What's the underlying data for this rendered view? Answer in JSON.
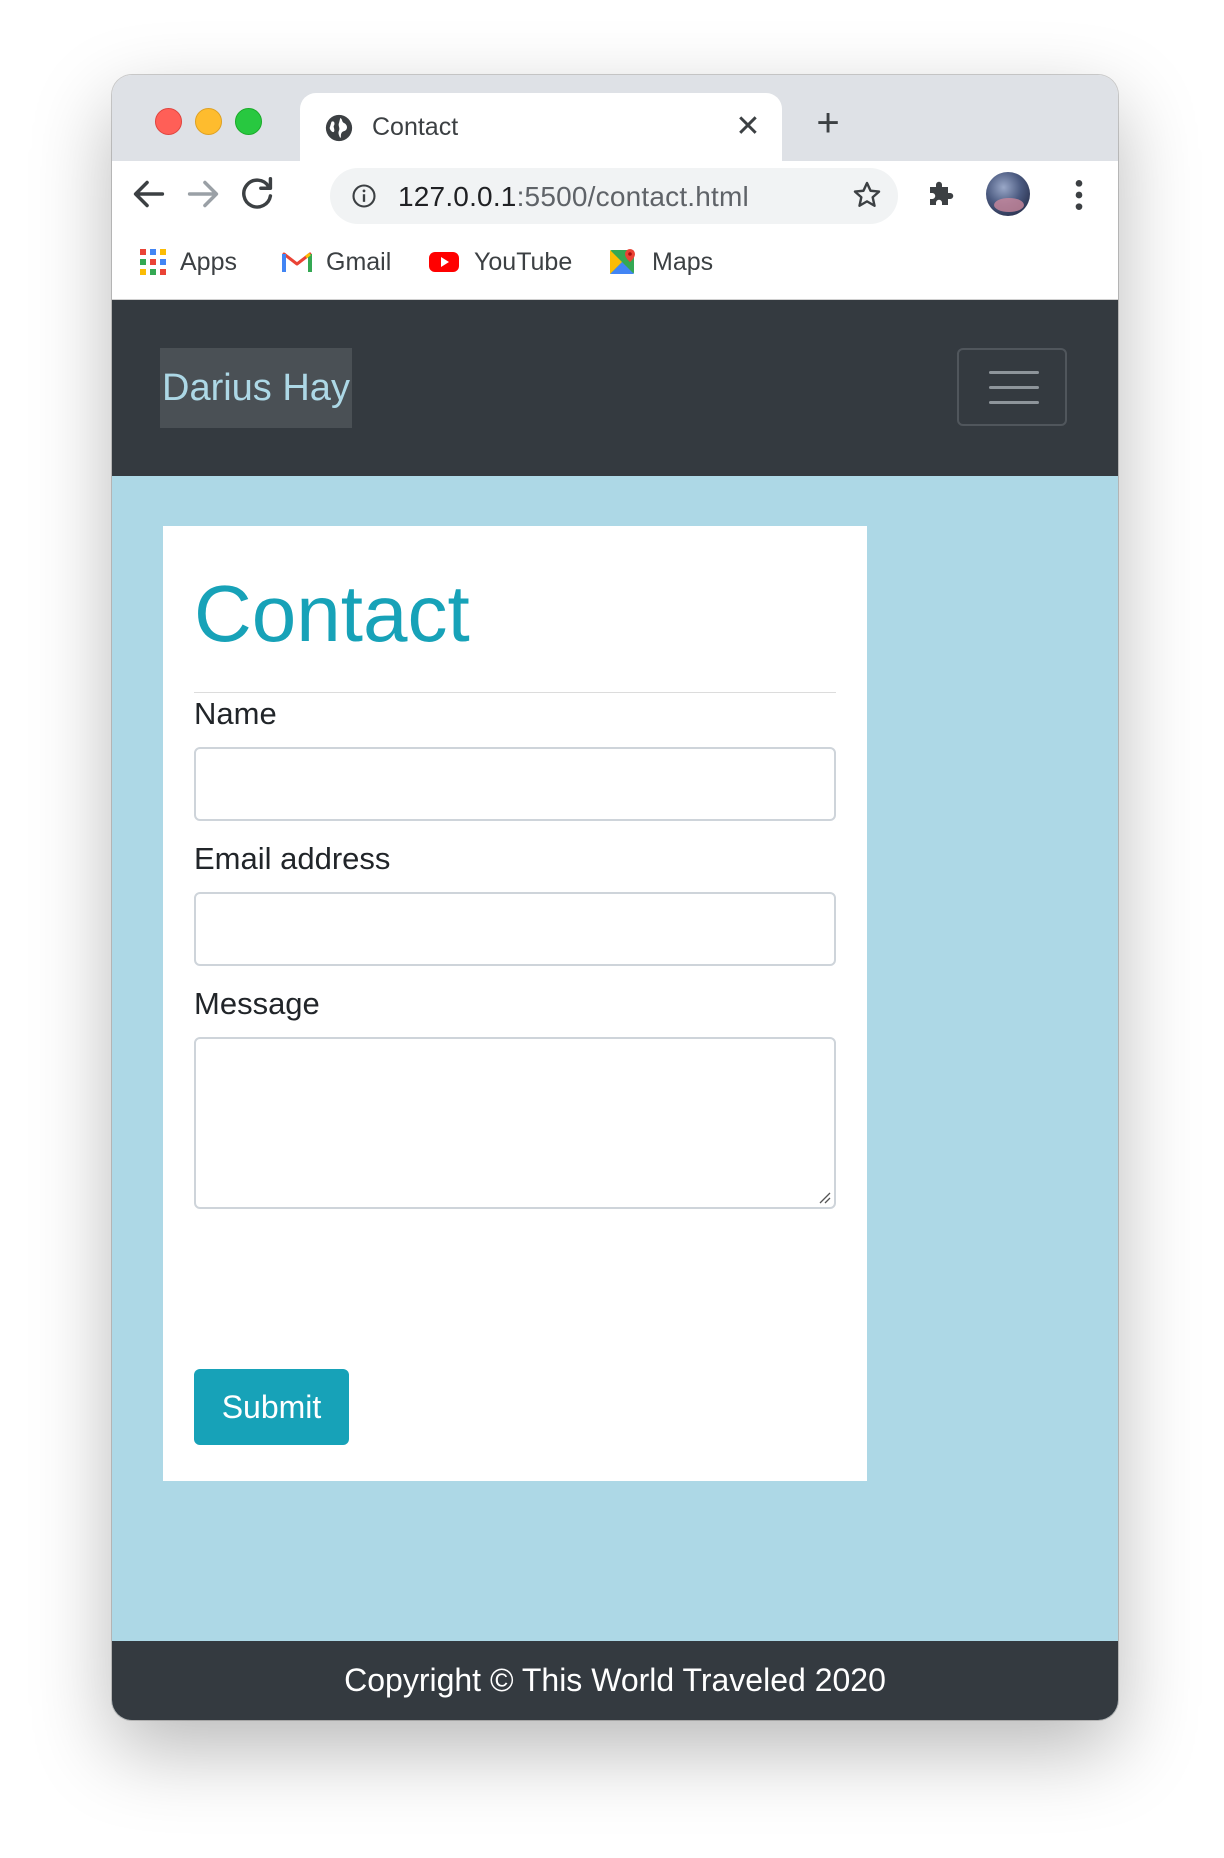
{
  "browser": {
    "tab": {
      "title": "Contact",
      "close_glyph": "✕"
    },
    "new_tab_glyph": "+",
    "url": {
      "host": "127.0.0.1",
      "rest": ":5500/contact.html"
    },
    "bookmarks": [
      {
        "label": "Apps",
        "icon": "apps-grid-icon"
      },
      {
        "label": "Gmail",
        "icon": "gmail-icon"
      },
      {
        "label": "YouTube",
        "icon": "youtube-icon"
      },
      {
        "label": "Maps",
        "icon": "maps-icon"
      }
    ]
  },
  "page": {
    "navbar": {
      "brand": "Darius Hay"
    },
    "contact": {
      "title": "Contact",
      "fields": {
        "name_label": "Name",
        "email_label": "Email address",
        "message_label": "Message"
      },
      "submit_label": "Submit"
    },
    "footer": {
      "text": "Copyright © This World Traveled 2020"
    }
  },
  "colors": {
    "page_background": "#add8e6",
    "navbar": "#343a40",
    "accent": "#17a2b8",
    "brand_text": "#add8e6"
  }
}
